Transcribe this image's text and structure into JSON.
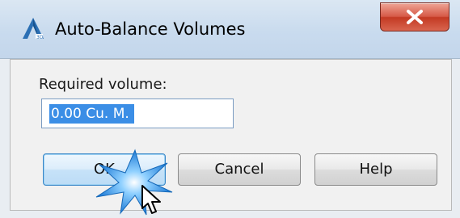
{
  "window": {
    "title": "Auto-Balance Volumes",
    "app_icon": "autocad-a-icon",
    "close_glyph": "close-x-icon"
  },
  "form": {
    "label": "Required volume:",
    "value": "0.00 Cu. M."
  },
  "buttons": {
    "ok": "OK",
    "cancel": "Cancel",
    "help": "Help"
  },
  "colors": {
    "selection": "#3b8ee6",
    "close_button": "#c33a23",
    "ok_highlight": "#3b87c8",
    "click_burst": "#1e7bd6"
  }
}
